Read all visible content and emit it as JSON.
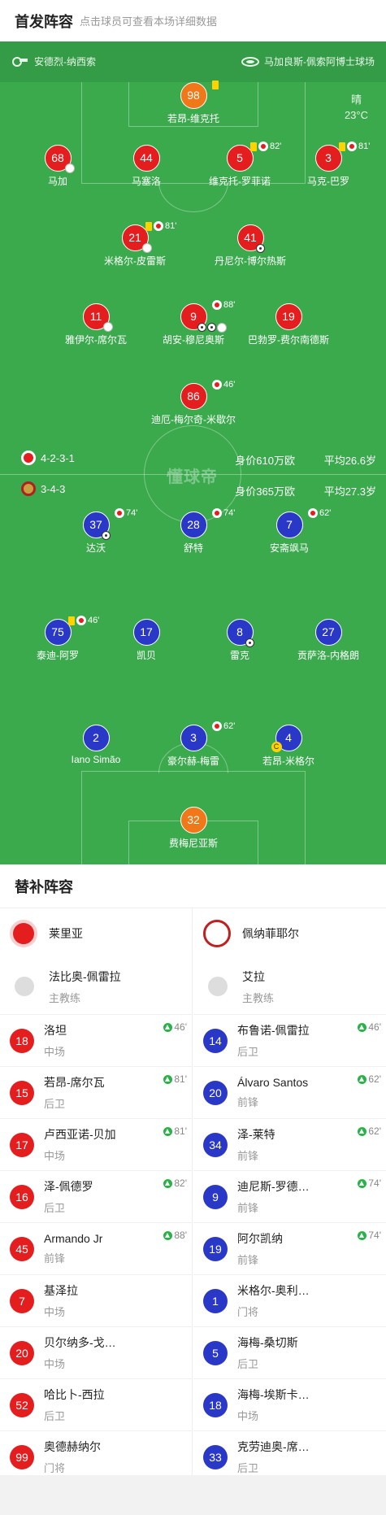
{
  "header": {
    "title": "首发阵容",
    "hint": "点击球员可查看本场详细数据"
  },
  "venue": {
    "coach": "安德烈-纳西索",
    "stadium": "马加良斯-佩索阿博士球场"
  },
  "weather": {
    "condition": "晴",
    "temp": "23°C"
  },
  "watermark": "懂球帝",
  "home": {
    "formation": "4-2-3-1",
    "value": "身价610万欧",
    "avg_age": "平均26.6岁",
    "players": [
      {
        "num": "98",
        "name": "若昂-维克托",
        "events": ""
      },
      {
        "num": "68",
        "name": "马加",
        "events": ""
      },
      {
        "num": "44",
        "name": "马塞洛",
        "events": ""
      },
      {
        "num": "5",
        "name": "维克托-罗菲诺",
        "events": "82'"
      },
      {
        "num": "3",
        "name": "马克-巴罗",
        "events": "81'"
      },
      {
        "num": "21",
        "name": "米格尔-皮雷斯",
        "events": "81'"
      },
      {
        "num": "41",
        "name": "丹尼尔-博尔热斯",
        "events": ""
      },
      {
        "num": "11",
        "name": "雅伊尔-席尔瓦",
        "events": ""
      },
      {
        "num": "9",
        "name": "胡安-穆尼奥斯",
        "events": "88'"
      },
      {
        "num": "19",
        "name": "巴勃罗-费尔南德斯",
        "events": ""
      },
      {
        "num": "86",
        "name": "迪厄-梅尔奇-米歇尔",
        "events": "46'"
      }
    ]
  },
  "away": {
    "formation": "3-4-3",
    "value": "身价365万欧",
    "avg_age": "平均27.3岁",
    "players": [
      {
        "num": "37",
        "name": "达沃",
        "events": "74'"
      },
      {
        "num": "28",
        "name": "舒特",
        "events": "74'"
      },
      {
        "num": "7",
        "name": "安斋飒马",
        "events": "62'"
      },
      {
        "num": "75",
        "name": "泰迪-阿罗",
        "events": "46'"
      },
      {
        "num": "17",
        "name": "凯贝",
        "events": ""
      },
      {
        "num": "8",
        "name": "雷克",
        "events": ""
      },
      {
        "num": "27",
        "name": "贡萨洛-内格朗",
        "events": ""
      },
      {
        "num": "2",
        "name": "Iano Simão",
        "events": ""
      },
      {
        "num": "3",
        "name": "豪尔赫-梅雷",
        "events": "62'"
      },
      {
        "num": "4",
        "name": "若昂-米格尔",
        "events": ""
      },
      {
        "num": "32",
        "name": "费梅尼亚斯",
        "events": ""
      }
    ]
  },
  "subs": {
    "title": "替补阵容",
    "home_team": "莱里亚",
    "away_team": "佩纳菲耶尔",
    "home_coach": {
      "name": "法比奥-佩雷拉",
      "role": "主教练"
    },
    "away_coach": {
      "name": "艾拉",
      "role": "主教练"
    },
    "home": [
      {
        "num": "18",
        "name": "洛坦",
        "pos": "中场",
        "in": "46'"
      },
      {
        "num": "15",
        "name": "若昂-席尔瓦",
        "pos": "后卫",
        "in": "81'"
      },
      {
        "num": "17",
        "name": "卢西亚诺-贝加",
        "pos": "中场",
        "in": "81'"
      },
      {
        "num": "16",
        "name": "泽-佩德罗",
        "pos": "后卫",
        "in": "82'"
      },
      {
        "num": "45",
        "name": "Armando Jr",
        "pos": "前锋",
        "in": "88'"
      },
      {
        "num": "7",
        "name": "基泽拉",
        "pos": "中场",
        "in": ""
      },
      {
        "num": "20",
        "name": "贝尔纳多-戈…",
        "pos": "中场",
        "in": ""
      },
      {
        "num": "52",
        "name": "哈比卜-西拉",
        "pos": "后卫",
        "in": ""
      },
      {
        "num": "99",
        "name": "奥德赫纳尔",
        "pos": "门将",
        "in": ""
      }
    ],
    "away": [
      {
        "num": "14",
        "name": "布鲁诺-佩雷拉",
        "pos": "后卫",
        "in": "46'"
      },
      {
        "num": "20",
        "name": "Álvaro Santos",
        "pos": "前锋",
        "in": "62'"
      },
      {
        "num": "34",
        "name": "泽-莱特",
        "pos": "前锋",
        "in": "62'"
      },
      {
        "num": "9",
        "name": "迪尼斯-罗德…",
        "pos": "前锋",
        "in": "74'"
      },
      {
        "num": "19",
        "name": "阿尔凯纳",
        "pos": "前锋",
        "in": "74'"
      },
      {
        "num": "1",
        "name": "米格尔-奥利…",
        "pos": "门将",
        "in": ""
      },
      {
        "num": "5",
        "name": "海梅-桑切斯",
        "pos": "后卫",
        "in": ""
      },
      {
        "num": "18",
        "name": "海梅-埃斯卡…",
        "pos": "中场",
        "in": ""
      },
      {
        "num": "33",
        "name": "克劳迪奥-席…",
        "pos": "后卫",
        "in": ""
      }
    ]
  }
}
